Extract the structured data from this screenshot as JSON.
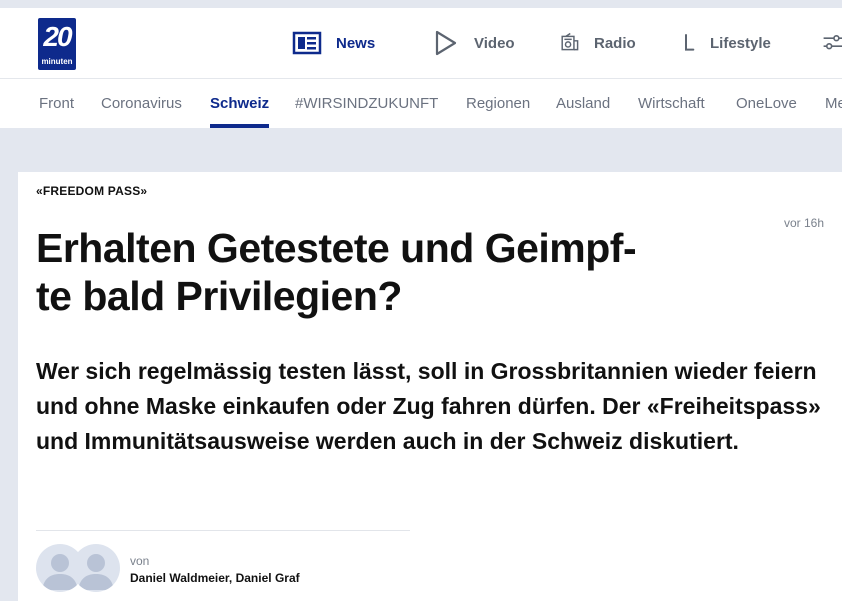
{
  "brand": {
    "logo_number": "20",
    "logo_sub": "minuten",
    "color": "#0e2a8c"
  },
  "main_nav": {
    "items": [
      {
        "label": "News",
        "icon": "newspaper-icon"
      },
      {
        "label": "Video",
        "icon": "play-icon"
      },
      {
        "label": "Radio",
        "icon": "radio-icon"
      },
      {
        "label": "Lifestyle",
        "icon": "lifestyle-icon"
      },
      {
        "label": "",
        "icon": "settings-sliders-icon"
      }
    ]
  },
  "sub_nav": {
    "tabs": [
      "Front",
      "Coronavirus",
      "Schweiz",
      "#WIRSINDZUKUNFT",
      "Regionen",
      "Ausland",
      "Wirtschaft",
      "OneLove",
      "Me"
    ],
    "active": "Schweiz"
  },
  "article": {
    "kicker": "«FREEDOM PASS»",
    "time": "vor 16h",
    "headline_line1": "Erhalten Getestete und Geimpf-",
    "headline_line2": "te bald Privilegien?",
    "lead": "Wer sich regelmässig testen lässt, soll in Grossbritannien wieder feiern und ohne Maske einkaufen oder Zug fahren dürfen. Der «Freiheitspass» und Immunitätsausweise werden auch in der Schweiz diskutiert.",
    "byline_prefix": "von",
    "authors": "Daniel Waldmeier, Daniel Graf"
  }
}
